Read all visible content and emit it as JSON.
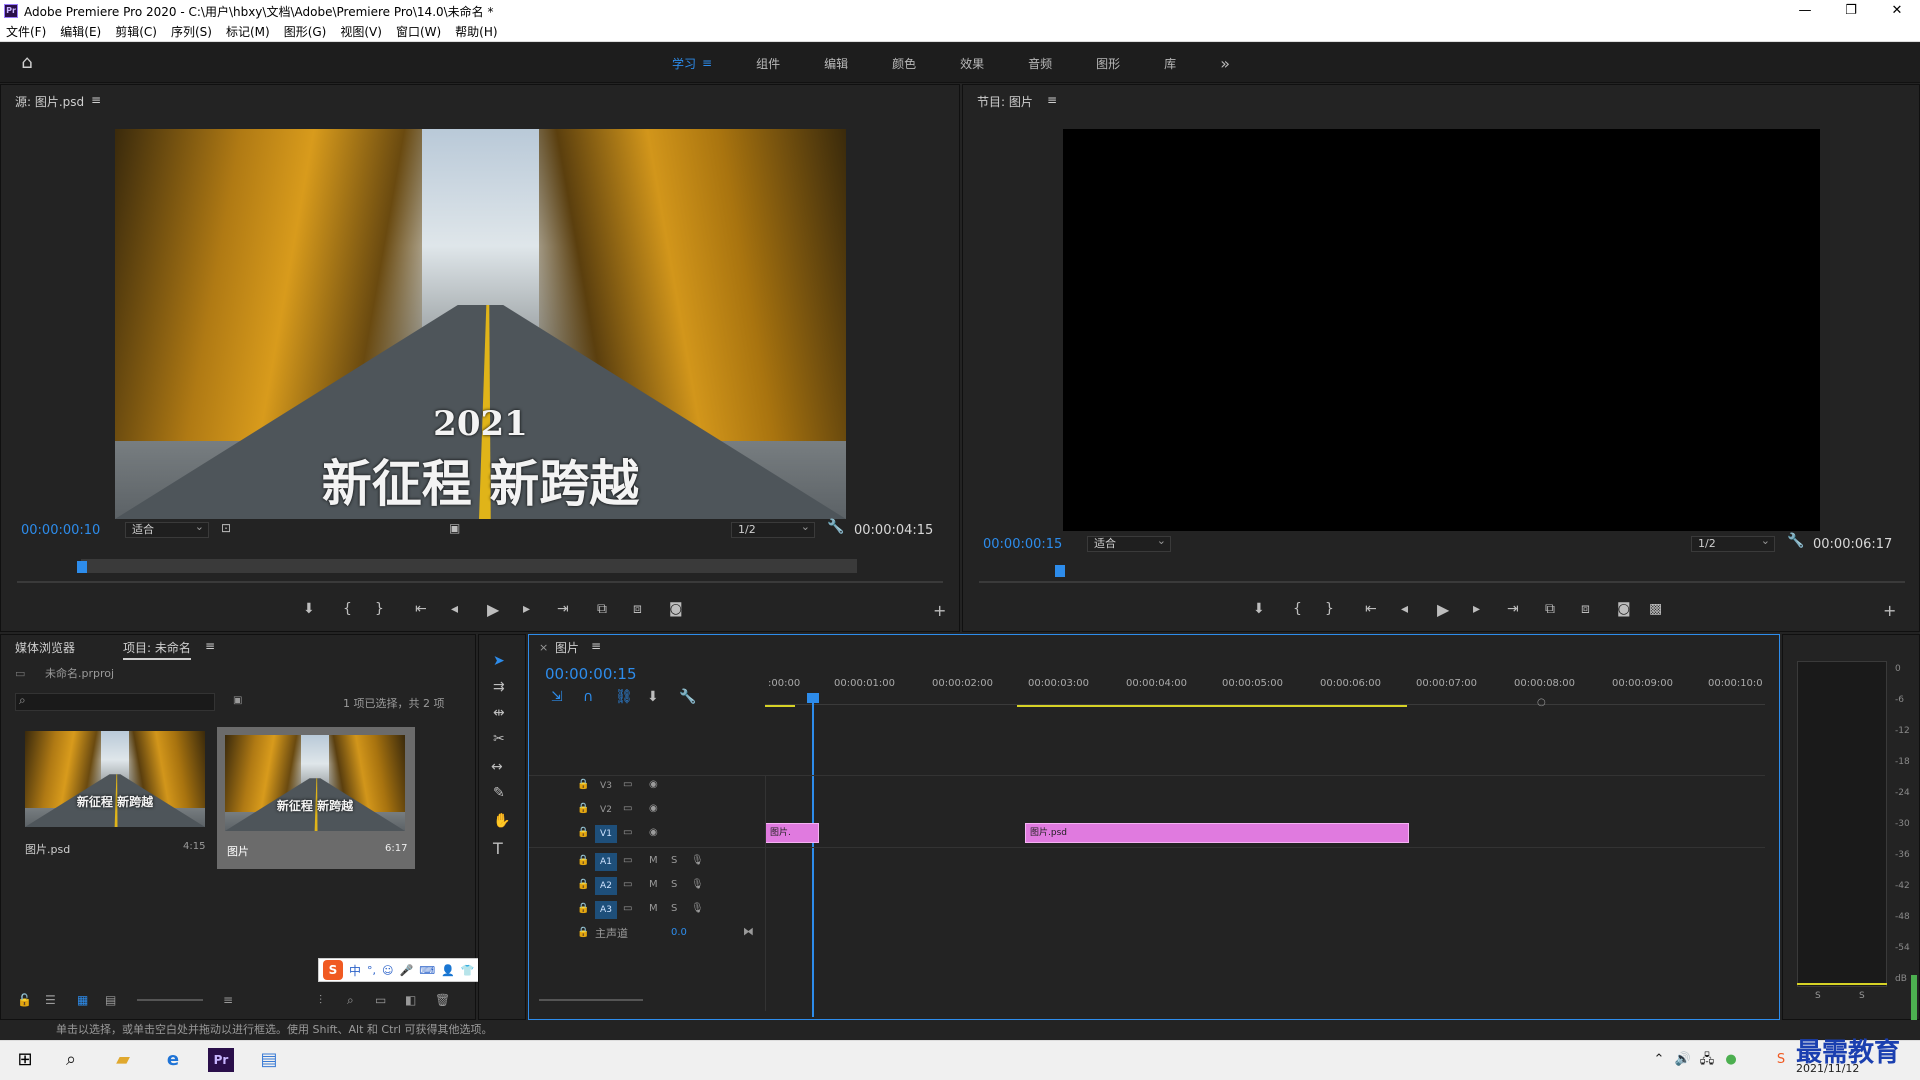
{
  "app": {
    "title": "Adobe Premiere Pro 2020 - C:\\用户\\hbxy\\文档\\Adobe\\Premiere Pro\\14.0\\未命名 *",
    "logo": "Pr",
    "window_controls": [
      "—",
      "❐",
      "✕"
    ]
  },
  "menu": [
    "文件(F)",
    "编辑(E)",
    "剪辑(C)",
    "序列(S)",
    "标记(M)",
    "图形(G)",
    "视图(V)",
    "窗口(W)",
    "帮助(H)"
  ],
  "workspaces": {
    "tabs": [
      "学习",
      "组件",
      "编辑",
      "颜色",
      "效果",
      "音频",
      "图形",
      "库"
    ],
    "active": "学习",
    "active_menu_icon": "≡",
    "more": "»"
  },
  "source_monitor": {
    "title": "源: 图片.psd",
    "menu_icon": "≡",
    "timecode_current": "00:00:00:10",
    "zoom": "适合",
    "resolution": "1/2",
    "timecode_duration": "00:00:04:15",
    "image_caption_year": "2021",
    "image_caption_text": "新征程 新跨越"
  },
  "program_monitor": {
    "title": "节目: 图片",
    "menu_icon": "≡",
    "timecode_current": "00:00:00:15",
    "zoom": "适合",
    "resolution": "1/2",
    "timecode_duration": "00:00:06:17"
  },
  "transport_icons": [
    "marker-icon",
    "mark-in-icon",
    "mark-out-icon",
    "go-to-in-icon",
    "step-back-icon",
    "play-icon",
    "step-forward-icon",
    "go-to-out-icon",
    "insert-icon",
    "overwrite-icon",
    "export-frame-icon"
  ],
  "project": {
    "tabs": [
      "媒体浏览器",
      "项目: 未命名"
    ],
    "active_tab": "项目: 未命名",
    "menu_icon": "≡",
    "file": "未命名.prproj",
    "search_placeholder": "",
    "selection_info": "1 项已选择，共 2 项",
    "items": [
      {
        "name": "图片.psd",
        "duration": "4:15",
        "caption": "新征程 新跨越"
      },
      {
        "name": "图片",
        "duration": "6:17",
        "caption": "新征程 新跨越"
      }
    ]
  },
  "timeline": {
    "tab_close": "×",
    "tab": "图片",
    "menu_icon": "≡",
    "timecode": "00:00:00:15",
    "ruler": ":00:00",
    "ruler_labels": [
      "00:00:01:00",
      "00:00:02:00",
      "00:00:03:00",
      "00:00:04:00",
      "00:00:05:00",
      "00:00:06:00",
      "00:00:07:00",
      "00:00:08:00",
      "00:00:09:00",
      "00:00:10:0"
    ],
    "video_tracks": [
      "V3",
      "V2",
      "V1"
    ],
    "audio_tracks": [
      "A1",
      "A2",
      "A3"
    ],
    "audio_buttons": [
      "M",
      "S"
    ],
    "master": {
      "label": "主声道",
      "value": "0.0"
    },
    "clips": [
      {
        "label": "图片.",
        "track": "V1",
        "start": 0,
        "end": 0.55
      },
      {
        "label": "图片.psd",
        "track": "V1",
        "start": 2.6,
        "end": 6.6
      }
    ],
    "playhead_seconds": 0.6
  },
  "audio_meter": {
    "labels": [
      "0",
      "-6",
      "-12",
      "-18",
      "-24",
      "-30",
      "-36",
      "-42",
      "-48",
      "-54",
      "dB"
    ],
    "solo": [
      "S",
      "S"
    ]
  },
  "statusbar": "单击以选择，或单击空白处并拖动以进行框选。使用 Shift、Alt 和 Ctrl 可获得其他选项。",
  "ime": {
    "labels": [
      "中",
      "°,",
      "☺",
      "🎤",
      "⌨",
      "👤",
      "👕",
      "▦"
    ]
  },
  "taskbar": {
    "date": "2021/11/12",
    "watermark": "最需教育"
  },
  "colors": {
    "accent": "#2d8ceb",
    "clip": "#e07adf",
    "bg": "#232323"
  }
}
